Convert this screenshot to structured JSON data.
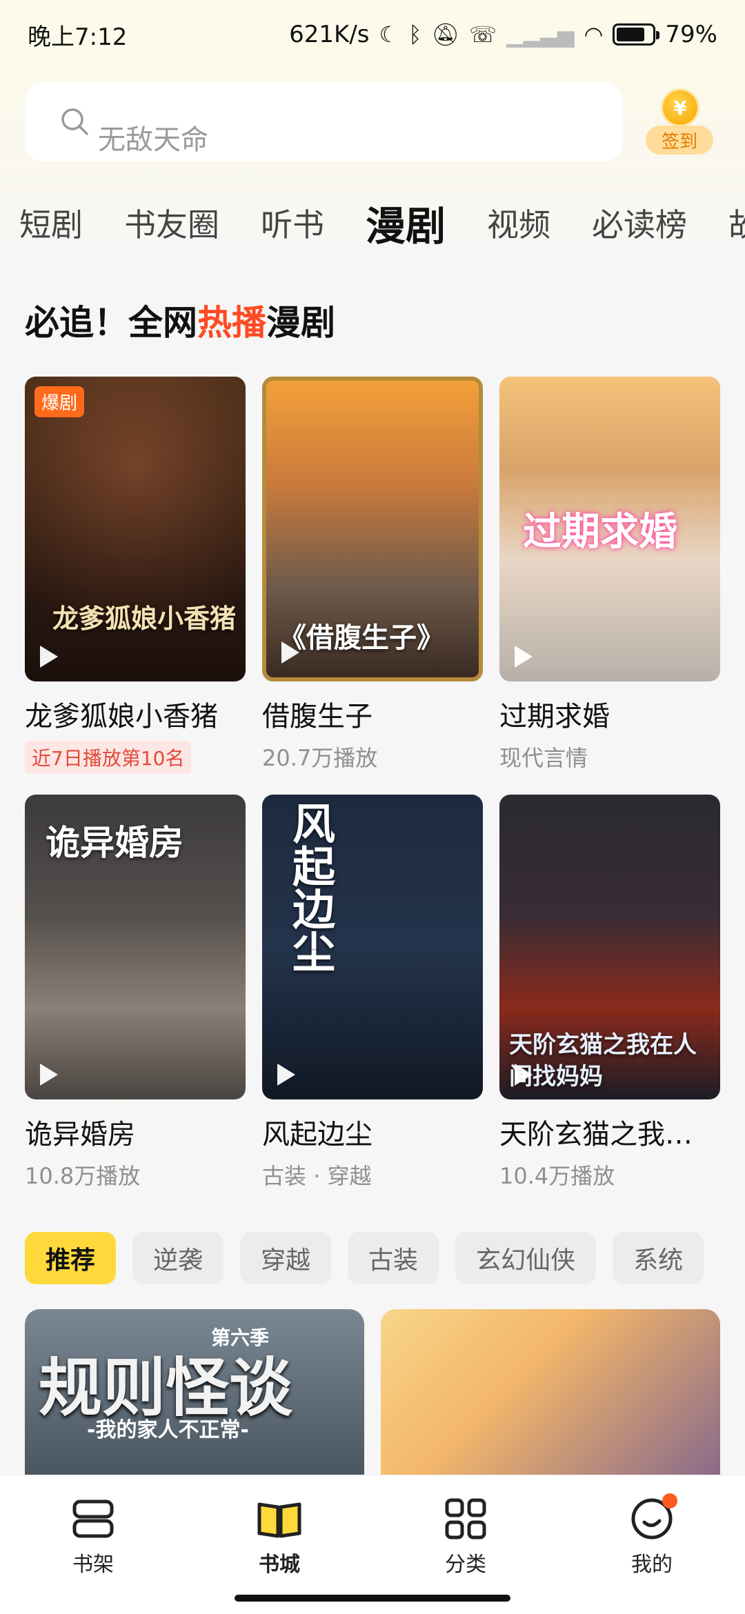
{
  "status_bar": {
    "time": "晚上7:12",
    "network_speed": "621K/s",
    "battery_percent": "79%",
    "battery_level": 0.79,
    "icons": [
      "moon-icon",
      "bluetooth-icon",
      "bell-off-icon",
      "call-icon",
      "signal-icon",
      "wifi-icon",
      "battery-icon"
    ]
  },
  "search": {
    "placeholder": "无敌天命",
    "checkin_label": "签到",
    "coin_symbol": "¥"
  },
  "tabs": [
    "短剧",
    "书友圈",
    "听书",
    "漫剧",
    "视频",
    "必读榜",
    "故事"
  ],
  "active_tab": "漫剧",
  "section": {
    "title_prefix": "必追！全网",
    "title_hot": "热播",
    "title_suffix": "漫剧"
  },
  "cards": [
    {
      "title": "龙爹狐娘小香猪",
      "sub": "近7日播放第10名",
      "badge": "爆剧",
      "cover_text": "龙爹狐娘小香猪"
    },
    {
      "title": "借腹生子",
      "sub": "20.7万播放",
      "cover_text": "《借腹生子》"
    },
    {
      "title": "过期求婚",
      "sub": "现代言情",
      "cover_text": "过期求婚"
    },
    {
      "title": "诡异婚房",
      "sub": "10.8万播放",
      "cover_text": "诡异婚房"
    },
    {
      "title": "风起边尘",
      "sub": "古装 · 穿越",
      "cover_text": "风起边尘"
    },
    {
      "title": "天阶玄猫之我…",
      "sub": "10.4万播放",
      "cover_text": "天阶玄猫之我在人间找妈妈"
    }
  ],
  "chips": [
    "推荐",
    "逆袭",
    "穿越",
    "古装",
    "玄幻仙侠",
    "系统"
  ],
  "active_chip": "推荐",
  "big_cards": [
    {
      "cover_text": "规则怪谈",
      "season": "第六季",
      "subtitle": "-我的家人不正常-"
    },
    {
      "cover_text": ""
    }
  ],
  "bottom_nav": [
    {
      "label": "书架",
      "icon": "bookshelf-icon"
    },
    {
      "label": "书城",
      "icon": "open-book-icon"
    },
    {
      "label": "分类",
      "icon": "grid-icon"
    },
    {
      "label": "我的",
      "icon": "profile-icon"
    }
  ],
  "active_nav": "书城",
  "colors": {
    "accent": "#ffd93b",
    "hot": "#ff4a22",
    "badge": "#ff6b1a"
  }
}
